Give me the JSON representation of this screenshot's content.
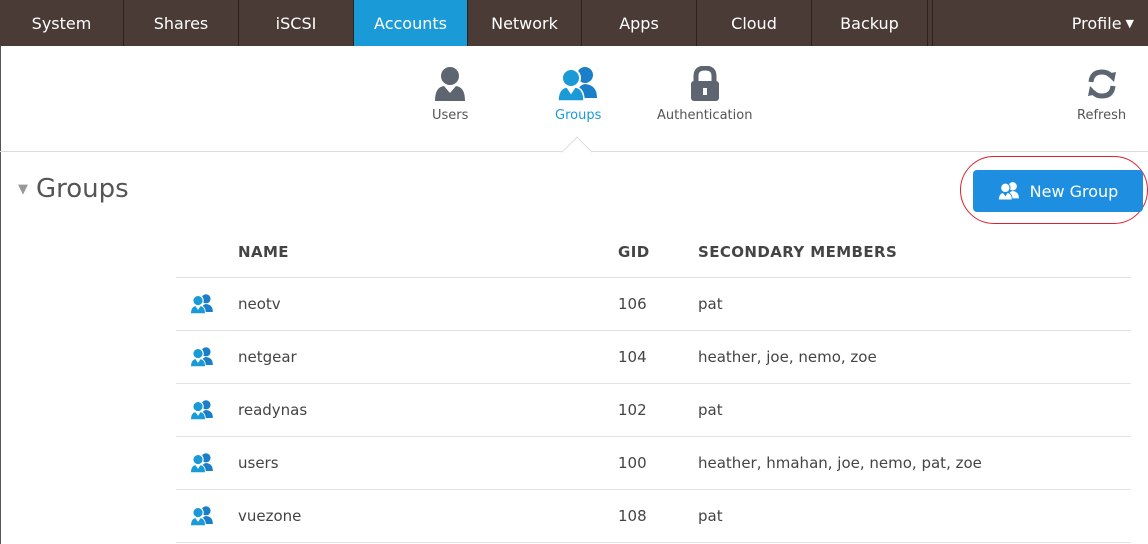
{
  "nav": {
    "tabs": [
      {
        "label": "System"
      },
      {
        "label": "Shares"
      },
      {
        "label": "iSCSI"
      },
      {
        "label": "Accounts"
      },
      {
        "label": "Network"
      },
      {
        "label": "Apps"
      },
      {
        "label": "Cloud"
      },
      {
        "label": "Backup"
      }
    ],
    "active_tab": "Accounts",
    "profile_label": "Profile",
    "profile_icon": "caret-down-icon"
  },
  "subnav": {
    "users_label": "Users",
    "groups_label": "Groups",
    "authentication_label": "Authentication",
    "refresh_label": "Refresh",
    "active": "Groups"
  },
  "section": {
    "title": "Groups",
    "new_group_label": "New Group"
  },
  "table": {
    "headers": {
      "name": "NAME",
      "gid": "GID",
      "members": "SECONDARY MEMBERS"
    },
    "rows": [
      {
        "name": "neotv",
        "gid": "106",
        "members": "pat"
      },
      {
        "name": "netgear",
        "gid": "104",
        "members": "heather, joe, nemo, zoe"
      },
      {
        "name": "readynas",
        "gid": "102",
        "members": "pat"
      },
      {
        "name": "users",
        "gid": "100",
        "members": "heather, hmahan, joe, nemo, pat, zoe"
      },
      {
        "name": "vuezone",
        "gid": "108",
        "members": "pat"
      }
    ]
  },
  "colors": {
    "nav_bg": "#4a3b36",
    "accent": "#1a9ad6",
    "button_bg": "#1e8fe0",
    "highlight_ring": "#d9232f"
  }
}
